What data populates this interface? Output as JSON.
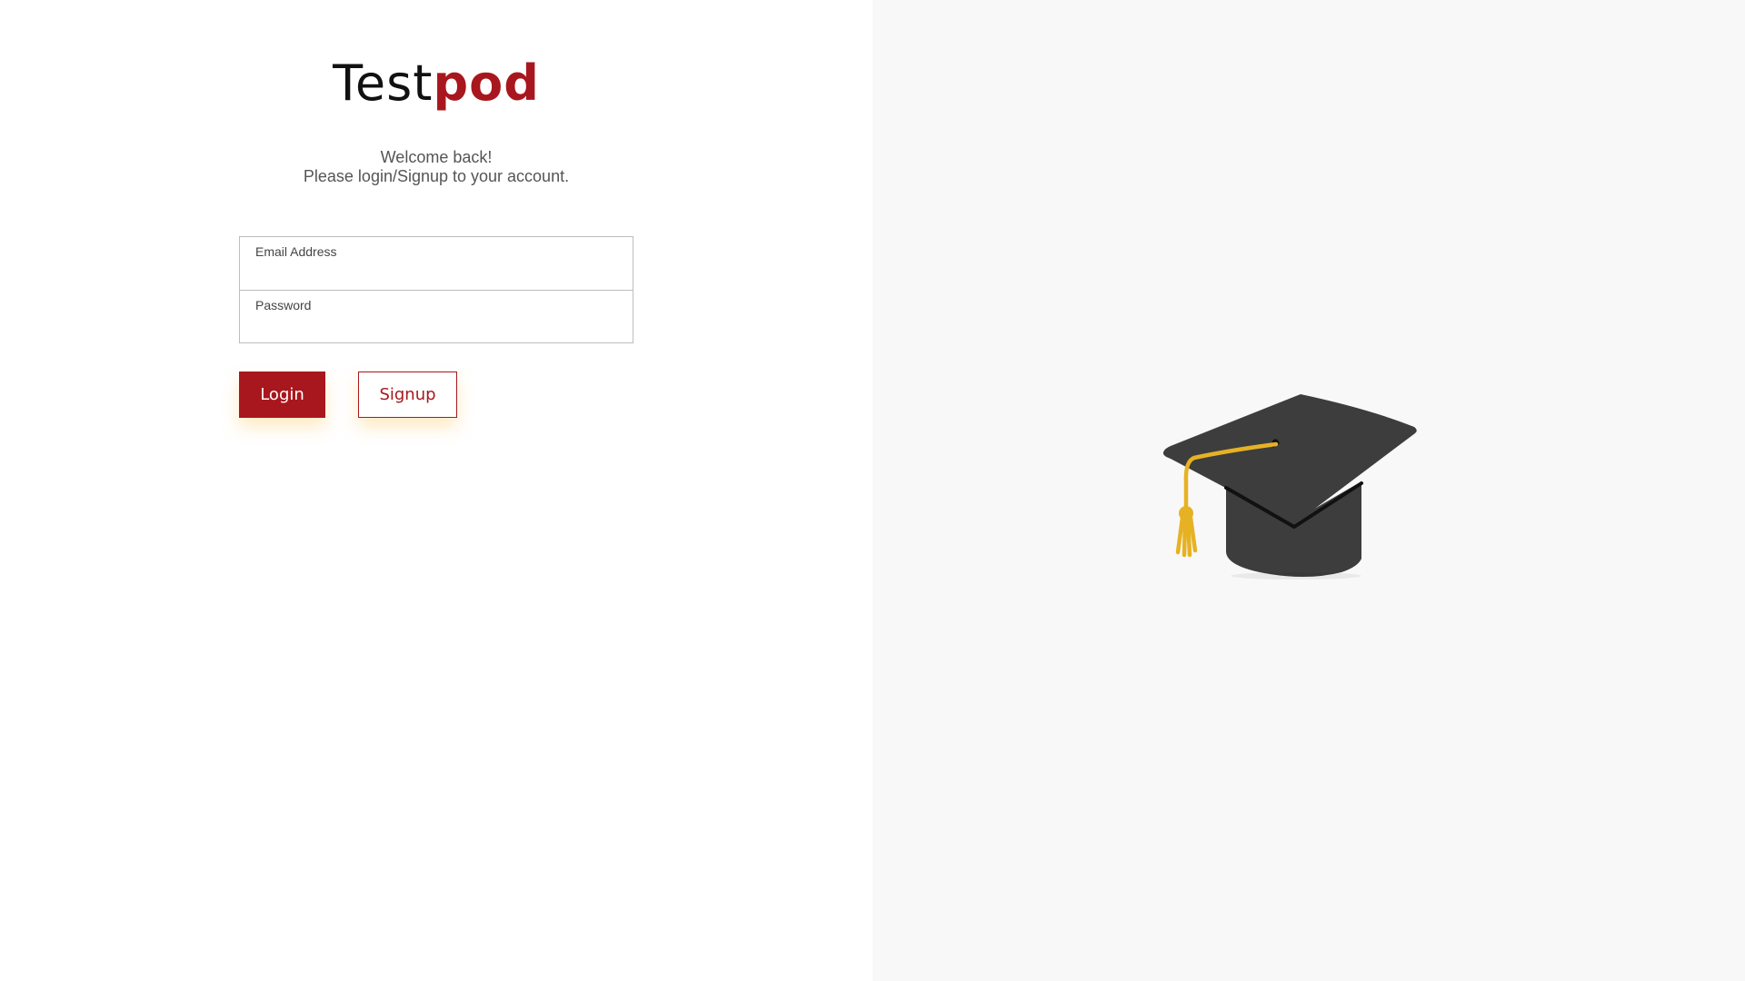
{
  "brand": {
    "name_part1": "Test",
    "name_part2": "pod",
    "accent_color": "#a8171d"
  },
  "welcome": {
    "line1": "Welcome back!",
    "line2": "Please login/Signup to your account."
  },
  "form": {
    "email_label": "Email Address",
    "email_value": "",
    "password_label": "Password",
    "password_value": ""
  },
  "buttons": {
    "login_label": "Login",
    "signup_label": "Signup"
  },
  "illustration": {
    "icon": "graduation-cap-icon",
    "cap_color": "#3d3d3d",
    "tassel_color": "#e6b224"
  }
}
